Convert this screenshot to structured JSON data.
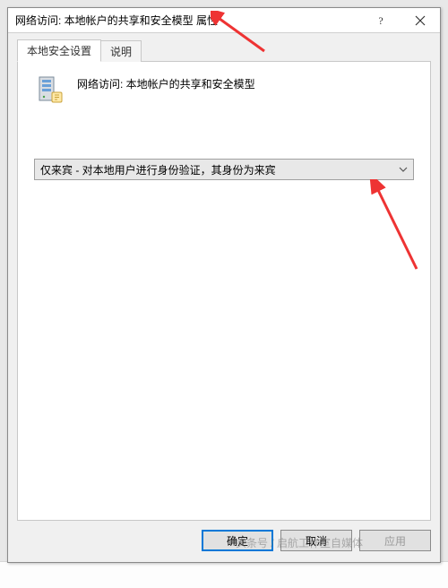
{
  "titlebar": {
    "title": "网络访问: 本地帐户的共享和安全模型 属性"
  },
  "tabs": {
    "settings": "本地安全设置",
    "explain": "说明"
  },
  "panel": {
    "heading": "网络访问: 本地帐户的共享和安全模型"
  },
  "select": {
    "value": "仅来宾 - 对本地用户进行身份验证，其身份为来宾"
  },
  "buttons": {
    "ok": "确定",
    "cancel": "取消",
    "apply": "应用"
  },
  "watermark": "头条号 / 启航工作室自媒体"
}
